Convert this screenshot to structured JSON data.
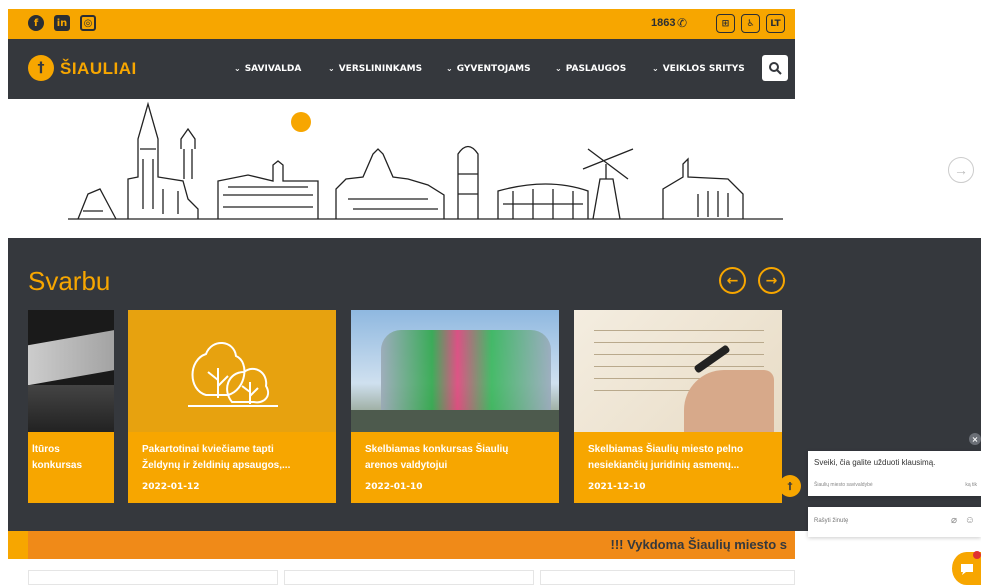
{
  "topbar": {
    "social": [
      "facebook-icon",
      "linkedin-icon",
      "instagram-icon"
    ],
    "phone": "1863",
    "lang": "LT"
  },
  "nav": {
    "logo": "ŠIAULIAI",
    "items": [
      "SAVIVALDA",
      "VERSLININKAMS",
      "GYVENTOJAMS",
      "PASLAUGOS",
      "VEIKLOS SRITYS"
    ]
  },
  "section": {
    "title": "Svarbu"
  },
  "cards": [
    {
      "title_line1": "ltūros",
      "title_line2": "konkursas",
      "date": ""
    },
    {
      "title_line1": "Pakartotinai kviečiame tapti",
      "title_line2": "Želdynų ir želdinių apsaugos,...",
      "date": "2022-01-12"
    },
    {
      "title_line1": "Skelbiamas konkursas Šiaulių",
      "title_line2": "arenos valdytojui",
      "date": "2022-01-10"
    },
    {
      "title_line1": "Skelbiamas Šiaulių miesto pelno",
      "title_line2": "nesiekiančių juridinių asmenų...",
      "date": "2021-12-10"
    }
  ],
  "ticker": "!!! Vykdoma Šiaulių miesto s",
  "chat": {
    "message": "Sveiki, čia galite užduoti klausimą.",
    "org": "Šiaulių miesto savivaldybė",
    "time": "ką tik",
    "placeholder": "Rašyti žinutę"
  },
  "colors": {
    "accent": "#f7a600",
    "dark": "#35383d",
    "ticker": "#f08a18"
  }
}
